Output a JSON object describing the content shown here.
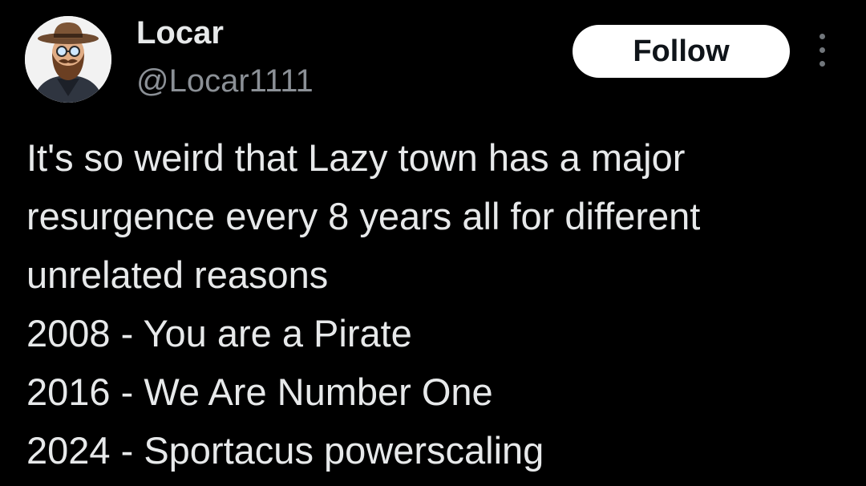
{
  "author": {
    "display_name": "Locar",
    "handle": "@Locar1111"
  },
  "actions": {
    "follow_label": "Follow",
    "more_icon": "more-vertical-icon"
  },
  "tweet": {
    "lines": [
      "It's so weird that Lazy town has a major",
      "resurgence every 8 years all for different",
      "unrelated reasons",
      "2008 - You are a Pirate",
      "2016 - We Are Number One",
      "2024 - Sportacus powerscaling"
    ]
  },
  "colors": {
    "background": "#000000",
    "text_primary": "#e7e9ea",
    "text_secondary": "#8b9096",
    "follow_bg": "#ffffff",
    "follow_text": "#0f1419"
  }
}
